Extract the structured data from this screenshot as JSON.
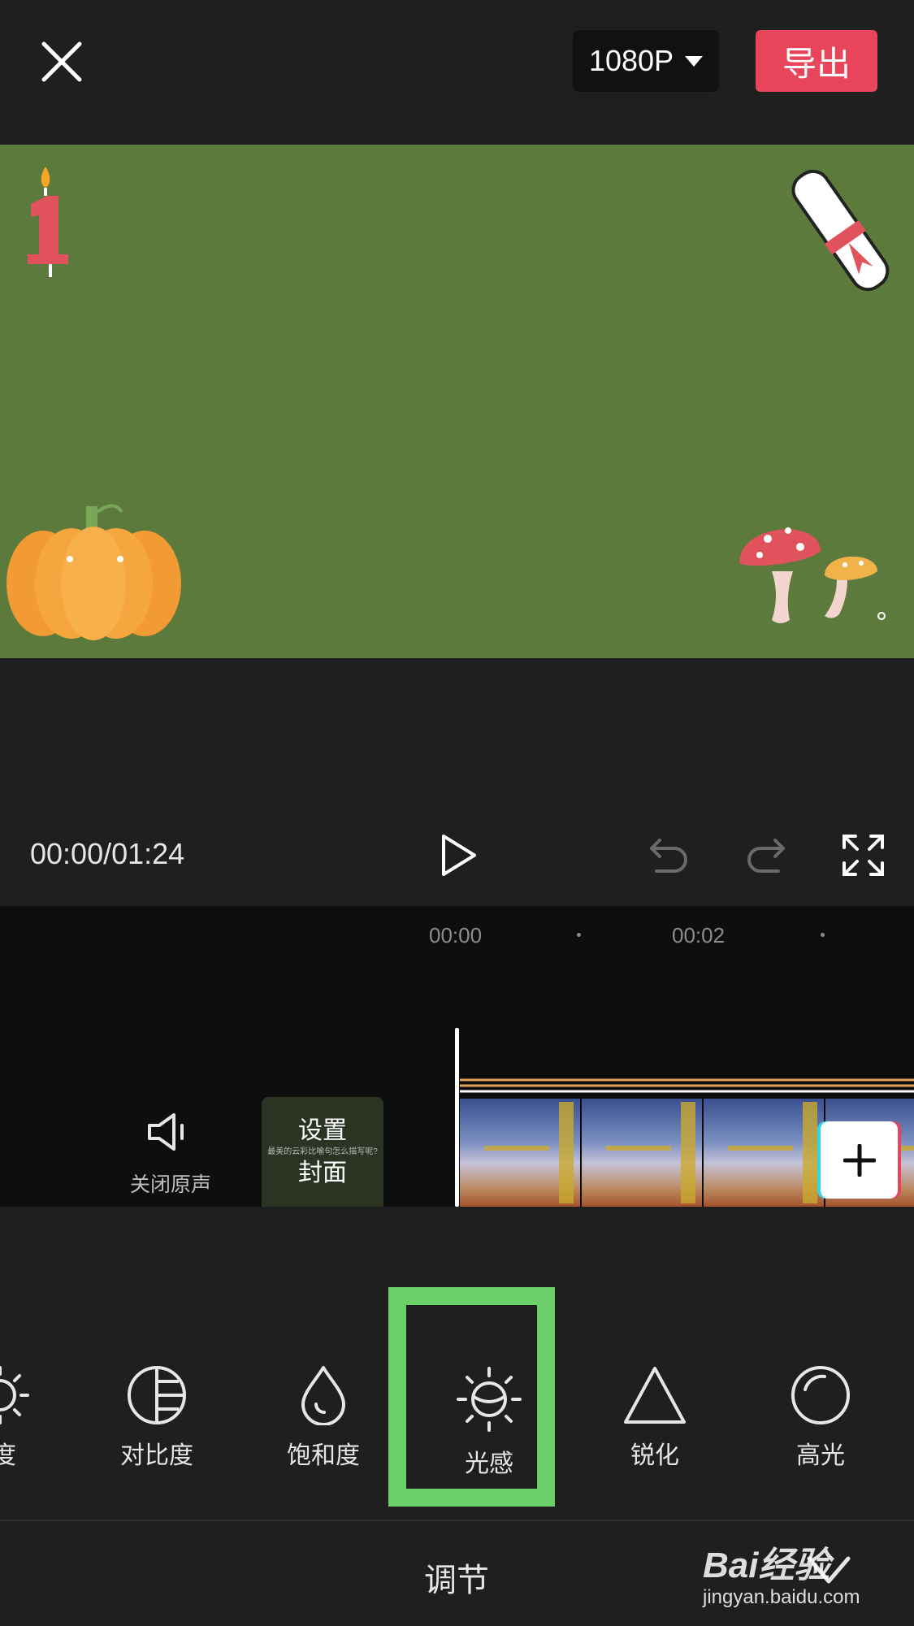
{
  "header": {
    "resolution_label": "1080P",
    "export_label": "导出"
  },
  "player": {
    "timecode": "00:00/01:24"
  },
  "timeline": {
    "ticks": [
      "00:00",
      "00:02"
    ],
    "mute_label": "关闭原声",
    "cover_line1": "设置",
    "cover_line2": "封面",
    "cover_caption": "最美的云彩比喻句怎么描写呢?"
  },
  "tools": [
    {
      "label": "度"
    },
    {
      "label": "对比度"
    },
    {
      "label": "饱和度"
    },
    {
      "label": "光感"
    },
    {
      "label": "锐化"
    },
    {
      "label": "高光"
    }
  ],
  "bottom": {
    "title": "调节"
  },
  "watermark": {
    "brand": "Bai经验",
    "url": "jingyan.baidu.com"
  },
  "colors": {
    "accent_export": "#e8445a",
    "highlight_box": "#6dcf6a",
    "preview_bg": "#5c7a3c"
  }
}
